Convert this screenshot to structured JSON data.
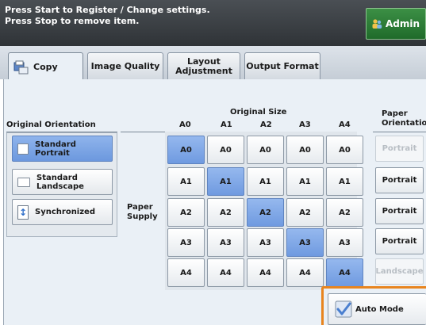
{
  "header": {
    "message_line1": "Press Start to Register / Change settings.",
    "message_line2": "Press Stop to remove item.",
    "admin_label": "Admin",
    "admin_icon": "admin-users-icon"
  },
  "tabs": [
    {
      "label": "Copy",
      "icon": "copy-icon",
      "active": true
    },
    {
      "label": "Image Quality",
      "active": false
    },
    {
      "label_line1": "Layout",
      "label_line2": "Adjustment",
      "active": false
    },
    {
      "label": "Output Format",
      "active": false
    }
  ],
  "orientation": {
    "title": "Original Orientation",
    "options": [
      {
        "line1": "Standard",
        "line2": "Portrait",
        "selected": true
      },
      {
        "line1": "Standard",
        "line2": "Landscape",
        "selected": false
      },
      {
        "line1": "Synchronized",
        "selected": false
      }
    ]
  },
  "original_size": {
    "title": "Original Size",
    "columns": [
      "A0",
      "A1",
      "A2",
      "A3",
      "A4"
    ]
  },
  "paper_supply": {
    "label_line1": "Paper",
    "label_line2": "Supply",
    "rows": [
      "A0",
      "A1",
      "A2",
      "A3",
      "A4"
    ],
    "selected_diagonal": true
  },
  "paper_orientation": {
    "title_line1": "Paper",
    "title_line2": "Orientation",
    "items": [
      {
        "label": "Portrait",
        "enabled": false
      },
      {
        "label": "Portrait",
        "enabled": true
      },
      {
        "label": "Portrait",
        "enabled": true
      },
      {
        "label": "Portrait",
        "enabled": true
      },
      {
        "label": "Landscape",
        "enabled": false
      }
    ]
  },
  "auto_mode": {
    "label": "Auto Mode",
    "checked": true
  },
  "colors": {
    "accent": "#6f9ae0",
    "highlight": "#e8851f",
    "header": "#3a3f44",
    "admin": "#2e7d37"
  }
}
